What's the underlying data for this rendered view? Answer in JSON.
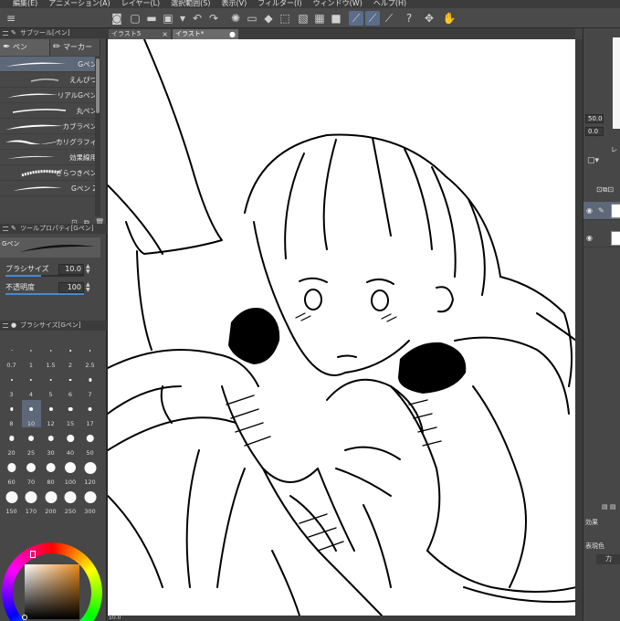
{
  "menubar": {
    "items": [
      "編集(E)",
      "アニメーション(A)",
      "レイヤー(L)",
      "選択範囲(S)",
      "表示(V)",
      "フィルター(I)",
      "ウィンドウ(W)",
      "ヘルプ(H)"
    ]
  },
  "toolbar": {
    "icons": [
      "canvas-icon",
      "new-file-icon",
      "open-icon",
      "save-icon",
      "undo-icon",
      "redo-icon",
      "transform-icon",
      "fill-icon",
      "crop-icon",
      "snap-icon",
      "ruler-icon",
      "help-icon",
      "move-icon"
    ]
  },
  "subtool": {
    "header": "サブツール[ペン]",
    "tabs": [
      {
        "label": "ペン",
        "icon": "pen-icon"
      },
      {
        "label": "マーカー",
        "icon": "marker-icon"
      }
    ],
    "brushes": [
      {
        "name": "Gペン"
      },
      {
        "name": "えんぴつ"
      },
      {
        "name": "リアルGペン"
      },
      {
        "name": "丸ペン"
      },
      {
        "name": "カブラペン"
      },
      {
        "name": "カリグラフィ"
      },
      {
        "name": "効果線用"
      },
      {
        "name": "ざらつきペン"
      },
      {
        "name": "Gペン 2"
      }
    ],
    "selected_index": 0
  },
  "tool_property": {
    "header": "ツールプロパティ[Gペン]",
    "preview_label": "Gペン",
    "brush_size_label": "ブラシサイズ",
    "brush_size_value": "10.0",
    "opacity_label": "不透明度",
    "opacity_value": "100",
    "brush_size_fraction": 0.45,
    "opacity_fraction": 1.0
  },
  "brush_size_palette": {
    "header": "ブラシサイズ[Gペン]",
    "sizes": [
      "0.7",
      "1",
      "1.5",
      "2",
      "2.5",
      "3",
      "4",
      "5",
      "6",
      "7",
      "8",
      "10",
      "12",
      "15",
      "17",
      "20",
      "25",
      "30",
      "40",
      "50",
      "60",
      "70",
      "80",
      "100",
      "120",
      "150",
      "170",
      "200",
      "250",
      "300"
    ],
    "selected": "10"
  },
  "color": {
    "current_hue": "#e88a1c",
    "main": "#000000",
    "sub": "#ffffff"
  },
  "document": {
    "tabs": [
      {
        "label": "イラスト5"
      },
      {
        "label": "イラスト*"
      }
    ],
    "active_tab": 1,
    "zoom": "50.0"
  },
  "right_panel": {
    "zoom_value": "50.0",
    "angle_value": "0.0",
    "layer_label": "レ",
    "effect_label": "効果",
    "display_color_label": "表現色",
    "effect_value": "力"
  }
}
